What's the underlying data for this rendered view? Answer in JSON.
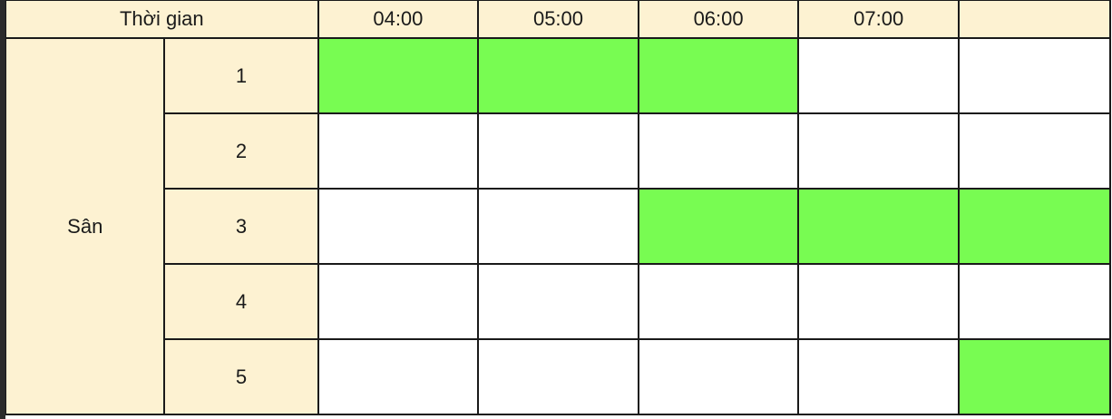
{
  "header": {
    "time_label": "Thời gian",
    "hours": [
      "04:00",
      "05:00",
      "06:00",
      "07:00",
      ""
    ]
  },
  "group_label": "Sân",
  "courts": [
    {
      "name": "1",
      "slots": [
        true,
        true,
        true,
        false,
        false
      ]
    },
    {
      "name": "2",
      "slots": [
        false,
        false,
        false,
        false,
        false
      ]
    },
    {
      "name": "3",
      "slots": [
        false,
        false,
        true,
        true,
        true
      ]
    },
    {
      "name": "4",
      "slots": [
        false,
        false,
        false,
        false,
        false
      ]
    },
    {
      "name": "5",
      "slots": [
        false,
        false,
        false,
        false,
        true
      ]
    }
  ],
  "colors": {
    "header_bg": "#fdf2d2",
    "booked": "#78fc52",
    "available": "#ffffff",
    "grid_line": "#1a1a1a"
  }
}
